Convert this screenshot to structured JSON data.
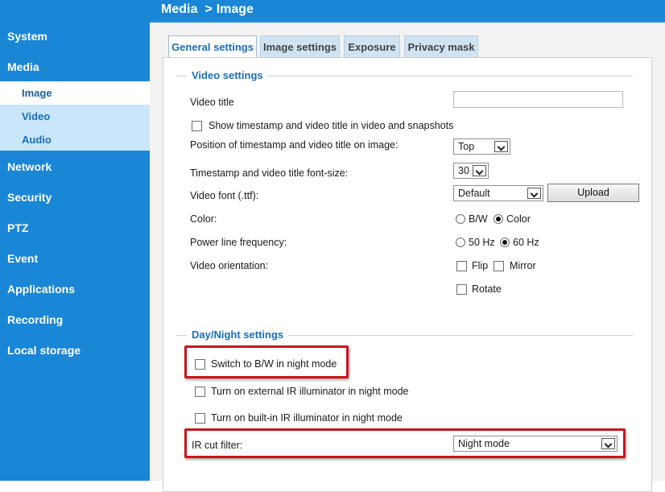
{
  "colors": {
    "primary": "#1a86d6",
    "sub_nav_bg": "#c9e6fa",
    "accent_text": "#1b6db8",
    "highlight": "#c8161d"
  },
  "header": {
    "section": "Media",
    "separator": ">",
    "page": "Image"
  },
  "sidebar": {
    "items": [
      {
        "label": "System"
      },
      {
        "label": "Media"
      },
      {
        "label": "Network"
      },
      {
        "label": "Security"
      },
      {
        "label": "PTZ"
      },
      {
        "label": "Event"
      },
      {
        "label": "Applications"
      },
      {
        "label": "Recording"
      },
      {
        "label": "Local storage"
      }
    ],
    "media_sub": [
      {
        "label": "Image",
        "active": true
      },
      {
        "label": "Video"
      },
      {
        "label": "Audio"
      }
    ]
  },
  "tabs": [
    {
      "label": "General settings",
      "active": true
    },
    {
      "label": "Image settings"
    },
    {
      "label": "Exposure"
    },
    {
      "label": "Privacy mask"
    }
  ],
  "video_settings": {
    "legend": "Video settings",
    "video_title": {
      "label": "Video title",
      "value": ""
    },
    "show_timestamp": {
      "label": "Show timestamp and video title in video and snapshots",
      "checked": false
    },
    "position": {
      "label": "Position of timestamp and video title on image:",
      "value": "Top"
    },
    "font_size": {
      "label": "Timestamp and video title font-size:",
      "value": "30"
    },
    "video_font": {
      "label": "Video font (.ttf):",
      "value": "Default",
      "upload_label": "Upload"
    },
    "color": {
      "label": "Color:",
      "options": [
        "B/W",
        "Color"
      ],
      "selected": "Color"
    },
    "power_line": {
      "label": "Power line frequency:",
      "options": [
        "50 Hz",
        "60 Hz"
      ],
      "selected": "60 Hz"
    },
    "orientation": {
      "label": "Video orientation:",
      "flip": "Flip",
      "mirror": "Mirror",
      "rotate": "Rotate"
    }
  },
  "day_night": {
    "legend": "Day/Night settings",
    "switch_bw": {
      "label": "Switch to B/W in night mode",
      "checked": false
    },
    "external_ir": {
      "label": "Turn on external IR illuminator in night mode",
      "checked": false
    },
    "builtin_ir": {
      "label": "Turn on built-in IR illuminator in night mode",
      "checked": false
    },
    "ir_cut": {
      "label": "IR cut filter:",
      "value": "Night mode"
    }
  }
}
